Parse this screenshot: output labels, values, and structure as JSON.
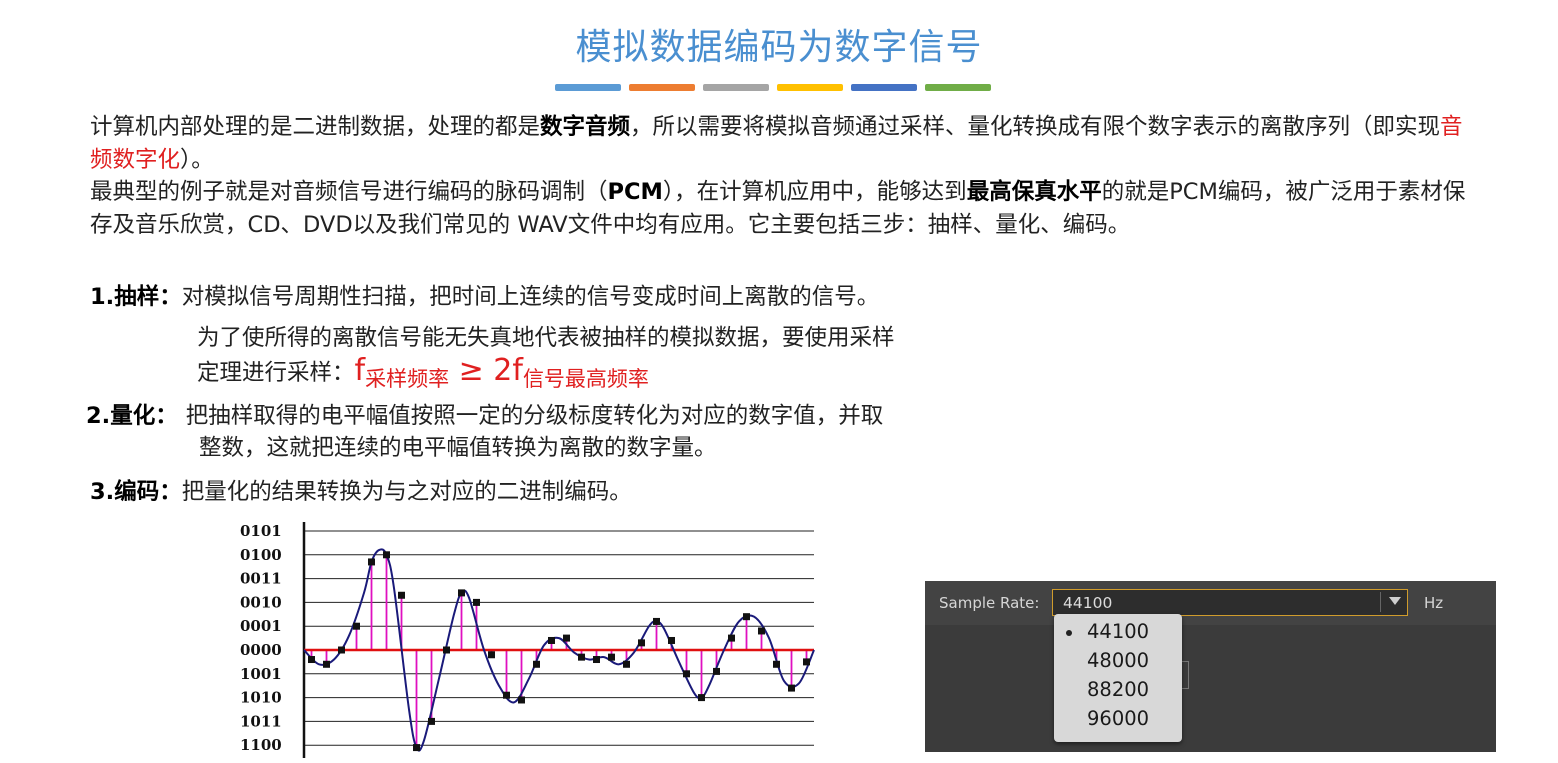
{
  "title": "模拟数据编码为数字信号",
  "accent_bars": [
    "#5b9bd5",
    "#ed7d31",
    "#a5a5a5",
    "#ffc000",
    "#4472c4",
    "#70ad47"
  ],
  "p1": {
    "a": "计算机内部处理的是二进制数据，处理的都是",
    "b": "数字音频",
    "c": "，所以需要将模拟音频通过采样、量化转换成有限个数字表示的离散序列（即实现",
    "d": "音频数字化",
    "e": "）。"
  },
  "p2": {
    "a": "最典型的例子就是对音频信号进行编码的脉码调制（",
    "b": "PCM",
    "c": "），在计算机应用中，能够达到",
    "d": "最高保真水平",
    "e": "的就是PCM编码，被广泛用于素材保存及音乐欣赏，CD、DVD以及我们常见的 WAV文件中均有应用。它主要包括三步：抽样、量化、编码。"
  },
  "step1": {
    "label": "1.抽样：",
    "line1": "对模拟信号周期性扫描，把时间上连续的信号变成时间上离散的信号。",
    "line2": "为了使所得的离散信号能无失真地代表被抽样的模拟数据，要使用采样",
    "line3": "定理进行采样：",
    "f1": "f",
    "sub1": "采样频率",
    "op": " ≥ 2f",
    "sub2": "信号最高频率"
  },
  "step2": {
    "label": "2.量化：",
    "line1": "把抽样取得的电平幅值按照一定的分级标度转化为对应的数字值，并取",
    "line2": "整数，这就把连续的电平幅值转换为离散的数字量。"
  },
  "step3": {
    "label": "3.编码：",
    "line1": "把量化的结果转换为与之对应的二进制编码。"
  },
  "chart_data": {
    "type": "line",
    "levels": [
      "0101",
      "0100",
      "0011",
      "0010",
      "0001",
      "0000",
      "1001",
      "1010",
      "1011",
      "1100"
    ],
    "level_values": [
      5,
      4,
      3,
      2,
      1,
      0,
      -1,
      -2,
      -3,
      -4
    ],
    "ylim": [
      -4.3,
      5.3
    ],
    "xlim": [
      0,
      34
    ],
    "curve": {
      "x": [
        0,
        1,
        2,
        3,
        4,
        4.5,
        5,
        5.5,
        6,
        7,
        7.5,
        8,
        9,
        10,
        10.5,
        11,
        12,
        13,
        14,
        15,
        16,
        17,
        18,
        19,
        20,
        21,
        22,
        23,
        23.5,
        24,
        25,
        26,
        26.5,
        27,
        28,
        29,
        30,
        31,
        32,
        33,
        34
      ],
      "y": [
        0,
        -0.6,
        -0.4,
        0.6,
        2.4,
        3.7,
        4.2,
        4.0,
        2.6,
        -2.5,
        -4.1,
        -3.8,
        -1.2,
        1.5,
        2.4,
        2.2,
        0,
        -1.5,
        -2.2,
        -1.2,
        0.2,
        0.5,
        -0.1,
        -0.4,
        -0.3,
        -0.6,
        -0.1,
        1.0,
        1.2,
        0.9,
        -0.5,
        -1.8,
        -2.0,
        -1.5,
        0,
        1.2,
        1.4,
        0.5,
        -1.3,
        -1.4,
        0
      ]
    },
    "samples": {
      "x": [
        0.5,
        1.5,
        2.5,
        3.5,
        4.5,
        5.5,
        6.5,
        7.5,
        8.5,
        9.5,
        10.5,
        11.5,
        12.5,
        13.5,
        14.5,
        15.5,
        16.5,
        17.5,
        18.5,
        19.5,
        20.5,
        21.5,
        22.5,
        23.5,
        24.5,
        25.5,
        26.5,
        27.5,
        28.5,
        29.5,
        30.5,
        31.5,
        32.5,
        33.5
      ],
      "y": [
        -0.4,
        -0.6,
        0,
        1.0,
        3.7,
        4.0,
        2.3,
        -4.1,
        -3.0,
        0,
        2.4,
        2.0,
        -0.2,
        -1.9,
        -2.1,
        -0.6,
        0.4,
        0.5,
        -0.3,
        -0.4,
        -0.3,
        -0.6,
        0.3,
        1.2,
        0.4,
        -1.0,
        -2.0,
        -0.9,
        0.5,
        1.4,
        0.8,
        -0.6,
        -1.6,
        -0.5
      ]
    }
  },
  "panel": {
    "sample_rate_label": "Sample Rate:",
    "selected": "44100",
    "unit": "Hz",
    "options": [
      "44100",
      "48000",
      "88200",
      "96000"
    ],
    "colors": {
      "background": "#3b3b3b",
      "focus_border": "#d09c2c",
      "dropdown": "#d8d8d8"
    }
  }
}
